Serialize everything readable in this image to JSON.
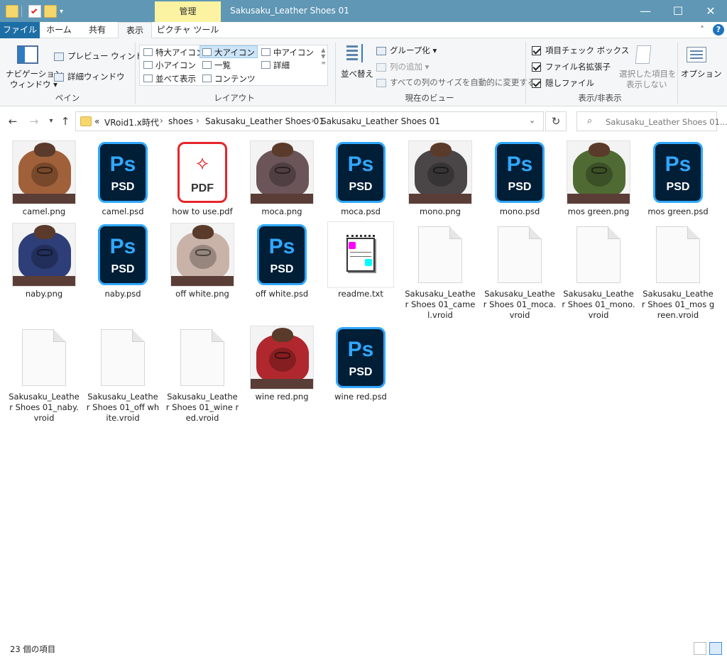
{
  "window": {
    "title": "Sakusaku_Leather Shoes 01",
    "context_tab": "管理",
    "minimize": "—",
    "maximize": "☐",
    "close": "✕"
  },
  "ribbon_tabs": [
    "ファイル",
    "ホーム",
    "共有",
    "表示",
    "ピクチャ ツール"
  ],
  "ribbon": {
    "pane": {
      "nav_pane_line1": "ナビゲーション",
      "nav_pane_line2": "ウィンドウ ▾",
      "preview": "プレビュー ウィンドウ",
      "details": "詳細ウィンドウ",
      "label": "ペイン"
    },
    "layout": {
      "items": [
        "特大アイコン",
        "大アイコン",
        "中アイコン",
        "小アイコン",
        "一覧",
        "詳細",
        "並べて表示",
        "コンテンツ"
      ],
      "selected": "大アイコン",
      "label": "レイアウト"
    },
    "current_view": {
      "sort": "並べ替え",
      "group": "グループ化 ▾",
      "add_column": "列の追加 ▾",
      "autosize": "すべての列のサイズを自動的に変更する",
      "label": "現在のビュー"
    },
    "show_hide": {
      "checkboxes": [
        "項目チェック ボックス",
        "ファイル名拡張子",
        "隠しファイル"
      ],
      "hide_selected_line1": "選択した項目を",
      "hide_selected_line2": "表示しない",
      "label": "表示/非表示"
    },
    "options": "オプション"
  },
  "address": {
    "overflow": "«",
    "crumbs": [
      "VRoid1.x時代",
      "shoes",
      "Sakusaku_Leather Shoes 01",
      "Sakusaku_Leather Shoes 01"
    ],
    "search_placeholder": "Sakusaku_Leather Shoes 01..."
  },
  "files": [
    {
      "name": "camel.png",
      "type": "png",
      "color": "#a0613a"
    },
    {
      "name": "camel.psd",
      "type": "psd"
    },
    {
      "name": "how to use.pdf",
      "type": "pdf"
    },
    {
      "name": "moca.png",
      "type": "png",
      "color": "#6b5558"
    },
    {
      "name": "moca.psd",
      "type": "psd"
    },
    {
      "name": "mono.png",
      "type": "png",
      "color": "#4a4648"
    },
    {
      "name": "mono.psd",
      "type": "psd"
    },
    {
      "name": "mos green.png",
      "type": "png",
      "color": "#4f6b33"
    },
    {
      "name": "mos green.psd",
      "type": "psd"
    },
    {
      "name": "naby.png",
      "type": "png",
      "color": "#2e3e78"
    },
    {
      "name": "naby.psd",
      "type": "psd"
    },
    {
      "name": "off white.png",
      "type": "png",
      "color": "#c9b3a9"
    },
    {
      "name": "off white.psd",
      "type": "psd"
    },
    {
      "name": "readme.txt",
      "type": "txt"
    },
    {
      "name": "Sakusaku_Leathe r Shoes 01_camel.vroid",
      "type": "vroid"
    },
    {
      "name": "Sakusaku_Leathe r Shoes 01_moca.vroid",
      "type": "vroid"
    },
    {
      "name": "Sakusaku_Leathe r Shoes 01_mono.vroid",
      "type": "vroid"
    },
    {
      "name": "Sakusaku_Leathe r Shoes 01_mos green.vroid",
      "type": "vroid"
    },
    {
      "name": "Sakusaku_Leathe r Shoes 01_naby.vroid",
      "type": "vroid"
    },
    {
      "name": "Sakusaku_Leathe r Shoes 01_off white.vroid",
      "type": "vroid"
    },
    {
      "name": "Sakusaku_Leathe r Shoes 01_wine red.vroid",
      "type": "vroid"
    },
    {
      "name": "wine red.png",
      "type": "png",
      "color": "#b0282d"
    },
    {
      "name": "wine red.psd",
      "type": "psd"
    }
  ],
  "psd_text": {
    "ps": "Ps",
    "label": "PSD"
  },
  "pdf_text": {
    "label": "PDF"
  },
  "status": {
    "item_count": "23 個の項目"
  }
}
